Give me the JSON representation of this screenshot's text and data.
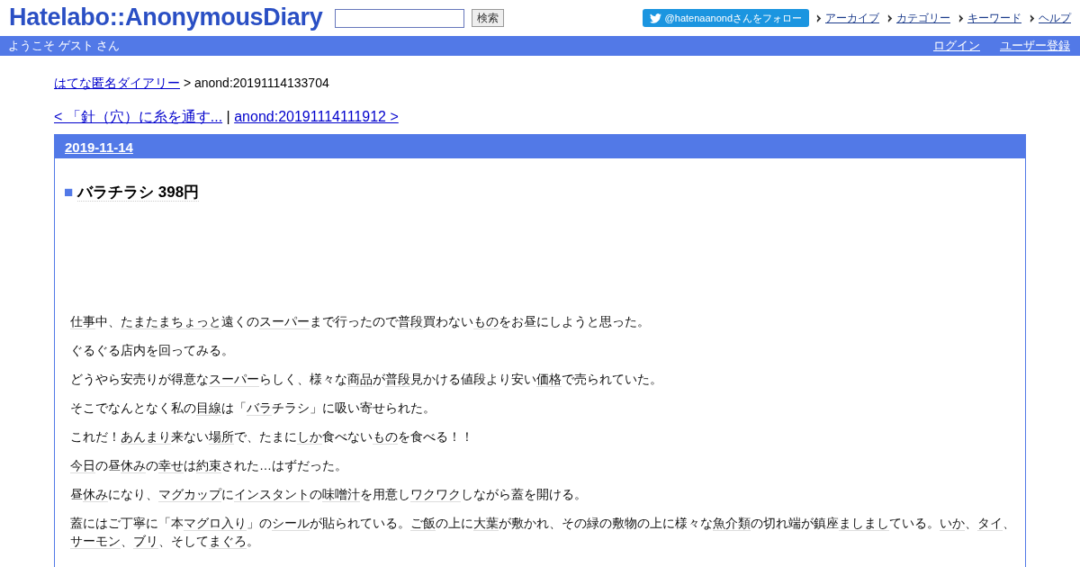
{
  "header": {
    "logo": "Hatelabo::AnonymousDiary",
    "search": {
      "button": "検索"
    },
    "follow_button": "@hatenaanondさんをフォロー",
    "nav_links": [
      "アーカイブ",
      "カテゴリー",
      "キーワード",
      "ヘルプ"
    ]
  },
  "user_bar": {
    "welcome": "ようこそ ゲスト さん",
    "links": [
      "ログイン",
      "ユーザー登録"
    ]
  },
  "breadcrumb": {
    "link": "はてな匿名ダイアリー",
    "current": "> anond:20191114133704"
  },
  "pager": {
    "prev": "< 「針（穴）に糸を通す...",
    "separator": "|",
    "next": "anond:20191114111912 >"
  },
  "day": {
    "date": "2019-11-14",
    "section": {
      "mark": "■",
      "title": "バラチラシ 398円"
    },
    "paragraphs": [
      [
        {
          "kind": "keyword",
          "text": "仕事"
        },
        {
          "kind": "plain",
          "text": "中、"
        },
        {
          "kind": "keyword",
          "text": "たまたまちょっと"
        },
        {
          "kind": "plain",
          "text": "遠くの"
        },
        {
          "kind": "keyword",
          "text": "スーパー"
        },
        {
          "kind": "plain",
          "text": "まで行ったので"
        },
        {
          "kind": "keyword",
          "text": "普段"
        },
        {
          "kind": "plain",
          "text": "買わない"
        },
        {
          "kind": "keyword",
          "text": "もの"
        },
        {
          "kind": "plain",
          "text": "をお昼にしようと思った。"
        }
      ],
      [
        {
          "kind": "plain",
          "text": "ぐるぐる店内を回ってみる。"
        }
      ],
      [
        {
          "kind": "plain",
          "text": "どうやら安売りが得意な"
        },
        {
          "kind": "keyword",
          "text": "スーパー"
        },
        {
          "kind": "plain",
          "text": "らしく、様々な"
        },
        {
          "kind": "keyword",
          "text": "商品"
        },
        {
          "kind": "plain",
          "text": "が"
        },
        {
          "kind": "keyword",
          "text": "普段"
        },
        {
          "kind": "plain",
          "text": "見かける値段より安い"
        },
        {
          "kind": "keyword",
          "text": "価格"
        },
        {
          "kind": "plain",
          "text": "で売られていた。"
        }
      ],
      [
        {
          "kind": "plain",
          "text": "そこでなんとなく私の"
        },
        {
          "kind": "keyword",
          "text": "目線"
        },
        {
          "kind": "plain",
          "text": "は「"
        },
        {
          "kind": "keyword",
          "text": "バラ"
        },
        {
          "kind": "plain",
          "text": "チラシ」に吸い寄せられた。"
        }
      ],
      [
        {
          "kind": "plain",
          "text": "これだ！"
        },
        {
          "kind": "keyword",
          "text": "あんまり"
        },
        {
          "kind": "plain",
          "text": "来ない"
        },
        {
          "kind": "keyword",
          "text": "場所"
        },
        {
          "kind": "plain",
          "text": "で、たまに"
        },
        {
          "kind": "keyword",
          "text": "しか"
        },
        {
          "kind": "plain",
          "text": "食べない"
        },
        {
          "kind": "keyword",
          "text": "もの"
        },
        {
          "kind": "plain",
          "text": "を食べる！！"
        }
      ],
      [
        {
          "kind": "keyword",
          "text": "今日"
        },
        {
          "kind": "plain",
          "text": "の昼"
        },
        {
          "kind": "keyword",
          "text": "休み"
        },
        {
          "kind": "plain",
          "text": "の"
        },
        {
          "kind": "keyword",
          "text": "幸せ"
        },
        {
          "kind": "plain",
          "text": "は"
        },
        {
          "kind": "keyword",
          "text": "約束"
        },
        {
          "kind": "plain",
          "text": "された…はずだった。"
        }
      ],
      [
        {
          "kind": "plain",
          "text": "昼"
        },
        {
          "kind": "keyword",
          "text": "休み"
        },
        {
          "kind": "plain",
          "text": "になり、"
        },
        {
          "kind": "keyword",
          "text": "マグカップ"
        },
        {
          "kind": "plain",
          "text": "に"
        },
        {
          "kind": "keyword",
          "text": "インスタント"
        },
        {
          "kind": "plain",
          "text": "の"
        },
        {
          "kind": "keyword",
          "text": "味噌汁"
        },
        {
          "kind": "plain",
          "text": "を用意し"
        },
        {
          "kind": "keyword",
          "text": "ワクワク"
        },
        {
          "kind": "plain",
          "text": "しながら蓋を開ける。"
        }
      ],
      [
        {
          "kind": "plain",
          "text": "蓋にはご丁寧に「本"
        },
        {
          "kind": "keyword",
          "text": "マグロ入り"
        },
        {
          "kind": "plain",
          "text": "」の"
        },
        {
          "kind": "keyword",
          "text": "シール"
        },
        {
          "kind": "plain",
          "text": "が貼られている。"
        },
        {
          "kind": "keyword",
          "text": "ご飯"
        },
        {
          "kind": "plain",
          "text": "の上に"
        },
        {
          "kind": "keyword",
          "text": "大葉"
        },
        {
          "kind": "plain",
          "text": "が敷かれ、その緑の敷物の上に様々な"
        },
        {
          "kind": "keyword",
          "text": "魚介類"
        },
        {
          "kind": "plain",
          "text": "の切れ端が鎮座"
        },
        {
          "kind": "keyword",
          "text": "ましまし"
        },
        {
          "kind": "plain",
          "text": "ている。"
        },
        {
          "kind": "keyword",
          "text": "いか"
        },
        {
          "kind": "plain",
          "text": "、"
        },
        {
          "kind": "keyword",
          "text": "タイ"
        },
        {
          "kind": "plain",
          "text": "、"
        },
        {
          "kind": "keyword",
          "text": "サーモン"
        },
        {
          "kind": "plain",
          "text": "、"
        },
        {
          "kind": "keyword",
          "text": "ブリ"
        },
        {
          "kind": "plain",
          "text": "、そして"
        },
        {
          "kind": "keyword",
          "text": "まぐろ"
        },
        {
          "kind": "plain",
          "text": "。"
        }
      ]
    ]
  }
}
